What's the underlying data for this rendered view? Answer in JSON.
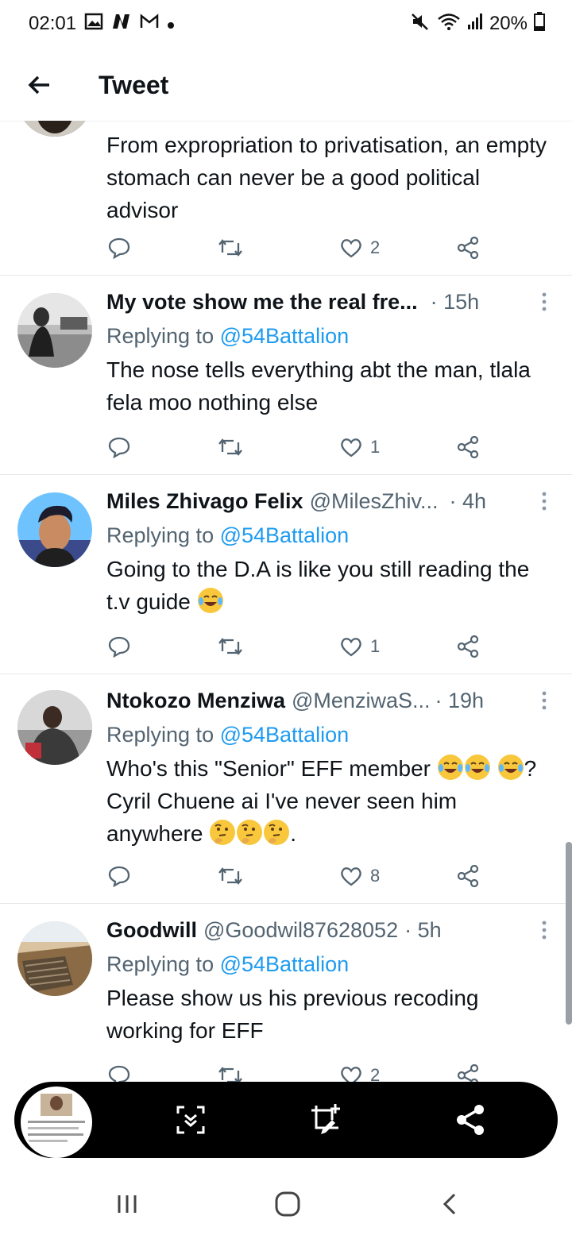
{
  "status_bar": {
    "time": "02:01",
    "notification_icons": [
      "gallery-icon",
      "n-logo-icon",
      "gmail-icon",
      "dot-icon"
    ],
    "battery": "20%",
    "right_icons": [
      "mute-icon",
      "wifi-icon",
      "signal-icon",
      "battery-icon"
    ]
  },
  "header": {
    "title": "Tweet"
  },
  "tweets": [
    {
      "name": "",
      "handle": "",
      "time": "",
      "replying_prefix": "",
      "replying_to": "",
      "text": "From expropriation to privatisation, an empty stomach can never be a good political advisor",
      "retweets": "",
      "likes": "2"
    },
    {
      "name": "My vote show me the real fre...",
      "handle": "",
      "time": "· 15h",
      "replying_prefix": "Replying to ",
      "replying_to": "@54Battalion",
      "text": "The nose tells everything abt the man, tlala fela moo nothing else",
      "likes": "1"
    },
    {
      "name": "Miles Zhivago Felix",
      "handle": "@MilesZhiv...",
      "time": "· 4h",
      "replying_prefix": "Replying to ",
      "replying_to": "@54Battalion",
      "text": "Going to the D.A is like you still reading the t.v guide",
      "emoji_after": "tears-of-joy",
      "likes": "1"
    },
    {
      "name": "Ntokozo Menziwa",
      "handle": "@MenziwaS...",
      "time": "· 19h",
      "replying_prefix": "Replying to ",
      "replying_to": "@54Battalion",
      "text_a": "Who's this \"Senior\" EFF member",
      "text_b": "? Cyril Chuene ai I've never seen him anywhere",
      "text_c": ".",
      "likes": "8"
    },
    {
      "name": "Goodwill",
      "handle": "@Goodwil87628052",
      "time": "· 5h",
      "replying_prefix": "Replying to ",
      "replying_to": "@54Battalion",
      "text": "Please show us his previous recoding working for EFF",
      "likes": "2"
    }
  ],
  "colors": {
    "link": "#1d9bf0",
    "muted": "#536471",
    "text": "#0f1419"
  },
  "screenshot_toolbar": {
    "buttons": [
      "scroll-capture-icon",
      "crop-edit-icon",
      "share-icon"
    ]
  },
  "nav_bar": {
    "buttons": [
      "recents-icon",
      "home-icon",
      "back-icon"
    ]
  }
}
